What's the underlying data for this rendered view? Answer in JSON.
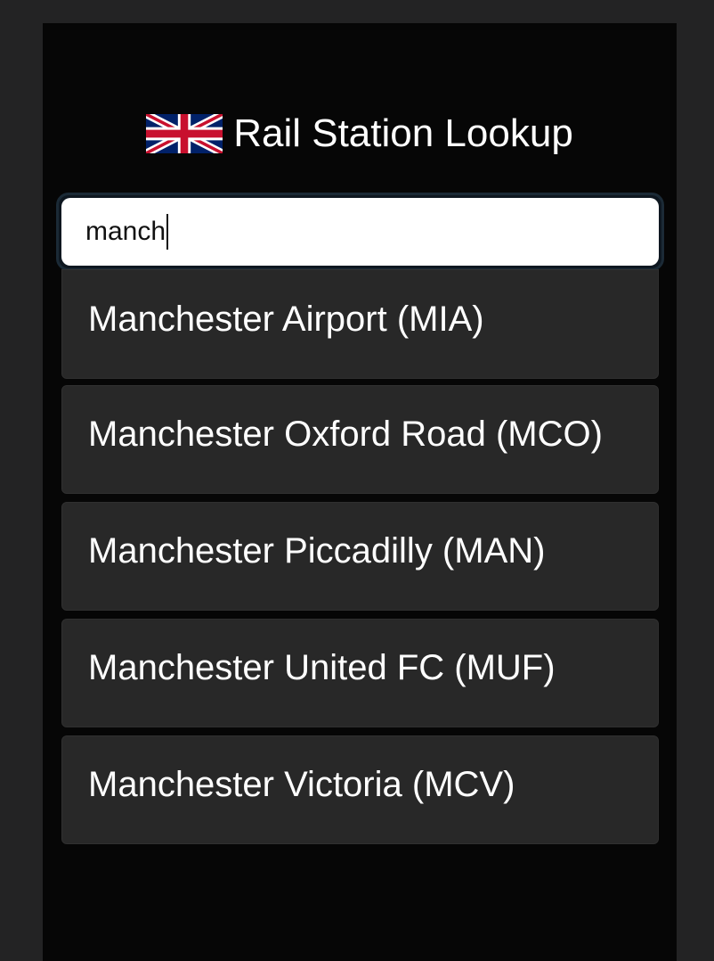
{
  "header": {
    "flag_icon": "uk-flag-icon",
    "title": "Rail Station Lookup"
  },
  "search": {
    "value": "manch"
  },
  "results": [
    "Manchester Airport (MIA)",
    "Manchester Oxford Road (MCO)",
    "Manchester Piccadilly (MAN)",
    "Manchester United FC (MUF)",
    "Manchester Victoria (MCV)"
  ],
  "colors": {
    "page_background": "#232324",
    "app_background": "#060606",
    "result_background": "#282828",
    "text": "#ffffff",
    "input_background": "#ffffff"
  }
}
